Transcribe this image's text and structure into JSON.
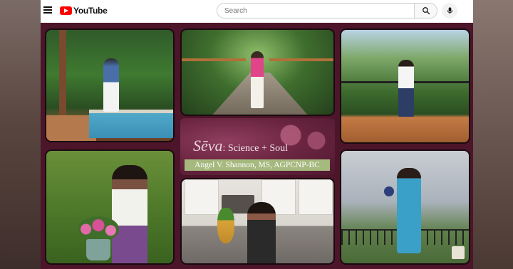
{
  "header": {
    "logo_text": "YouTube",
    "search_placeholder": "Search",
    "icons": [
      "menu-icon",
      "youtube-logo-icon",
      "search-icon",
      "microphone-icon"
    ]
  },
  "video": {
    "brand_script": "Sēva",
    "brand_title": ": Science + Soul",
    "presenter_name": "Angel V. Shannon, MS, AGPCNP-BC"
  },
  "colors": {
    "youtube_red": "#ff0000",
    "collage_background": "#4c1529",
    "name_bar": "#a6b97e"
  }
}
